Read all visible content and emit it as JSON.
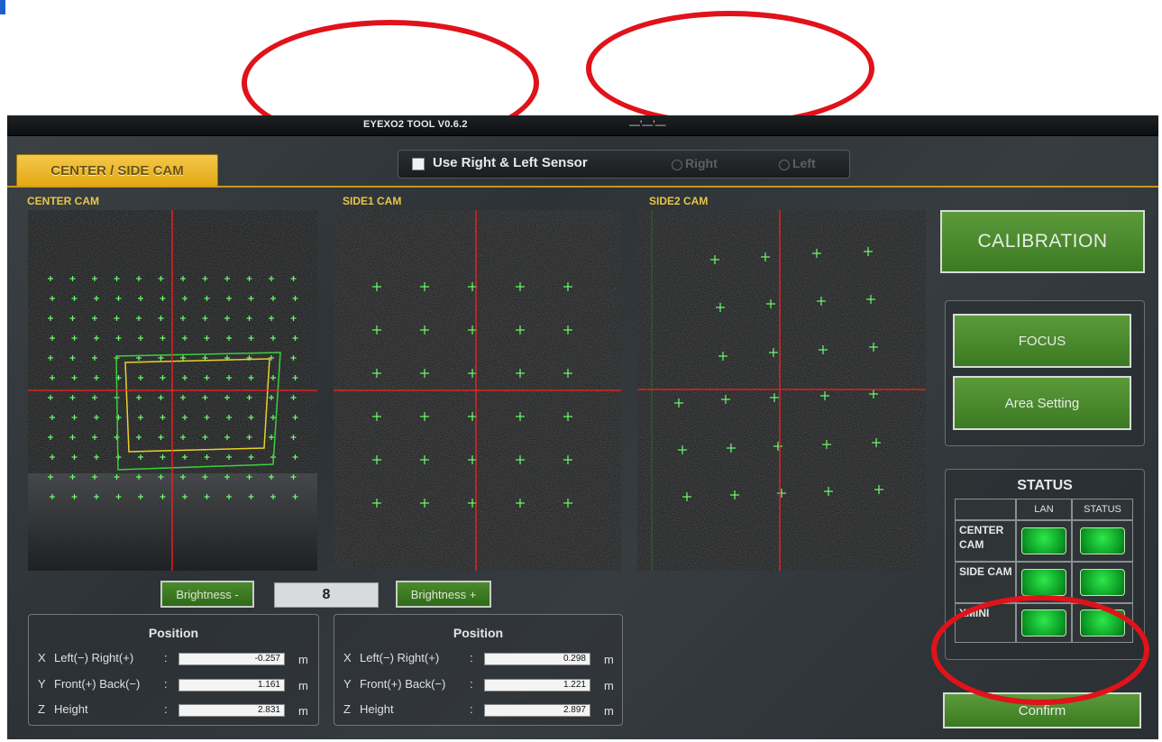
{
  "window": {
    "title": "EYEXO2 TOOL V0.6.2",
    "status_text": "—'—'—"
  },
  "tabs": {
    "active_label": "CENTER / SIDE CAM"
  },
  "sensor": {
    "checkbox_label": "Use Right & Left Sensor",
    "checked": false,
    "radio_right": "Right",
    "radio_left": "Left"
  },
  "cameras": {
    "center_label": "CENTER CAM",
    "side1_label": "SIDE1 CAM",
    "side2_label": "SIDE2 CAM"
  },
  "brightness": {
    "minus_label": "Brightness -",
    "value": "8",
    "plus_label": "Brightness +"
  },
  "position_left": {
    "title": "Position",
    "rows": [
      {
        "axis": "X",
        "label": "Left(−) Right(+)",
        "colon": ":",
        "value": "-0.257",
        "unit": "m"
      },
      {
        "axis": "Y",
        "label": "Front(+) Back(−)",
        "colon": ":",
        "value": "1.161",
        "unit": "m"
      },
      {
        "axis": "Z",
        "label": "Height",
        "colon": ":",
        "value": "2.831",
        "unit": "m"
      }
    ]
  },
  "position_right": {
    "title": "Position",
    "rows": [
      {
        "axis": "X",
        "label": "Left(−) Right(+)",
        "colon": ":",
        "value": "0.298",
        "unit": "m"
      },
      {
        "axis": "Y",
        "label": "Front(+) Back(−)",
        "colon": ":",
        "value": "1.221",
        "unit": "m"
      },
      {
        "axis": "Z",
        "label": "Height",
        "colon": ":",
        "value": "2.897",
        "unit": "m"
      }
    ]
  },
  "actions": {
    "calibration": "CALIBRATION",
    "focus": "FOCUS",
    "area_setting": "Area Setting",
    "confirm": "Confirm"
  },
  "status": {
    "title": "STATUS",
    "col_lan": "LAN",
    "col_status": "STATUS",
    "rows": [
      {
        "name": "CENTER CAM",
        "lan": "ok",
        "status": "ok"
      },
      {
        "name": "SIDE CAM",
        "lan": "ok",
        "status": "ok"
      },
      {
        "name": "XMINI",
        "lan": "ok",
        "status": "ok"
      }
    ]
  },
  "colors": {
    "accent_yellow": "#e3a916",
    "button_green": "#4a8a2c",
    "led_green": "#1ed23c",
    "crosshair_red": "#ff1e1e",
    "marker_green": "#6cff6c",
    "annotation_red": "#e0121a"
  }
}
